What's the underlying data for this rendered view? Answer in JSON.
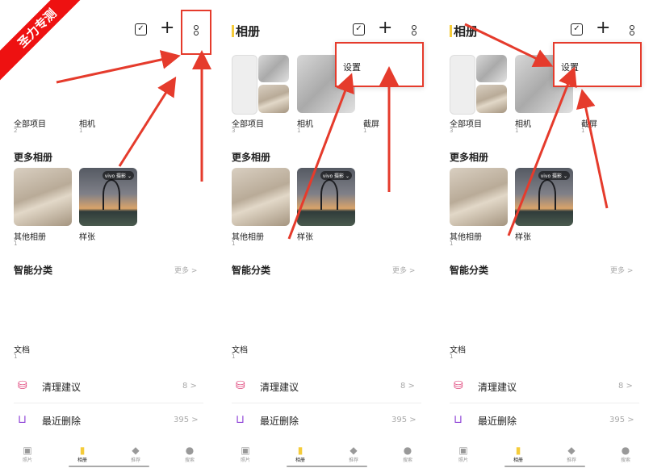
{
  "colors": {
    "accent": "#f5cc3a",
    "annotation": "#e53b2c"
  },
  "header": {
    "title": "相册"
  },
  "ribbon": "圣力专测",
  "albums_top": [
    {
      "name": "全部项目",
      "count": "2"
    },
    {
      "name": "相机",
      "count": "1"
    }
  ],
  "albums_top_p2": [
    {
      "name": "全部项目",
      "count": "3"
    },
    {
      "name": "相机",
      "count": "1"
    },
    {
      "name": "截屏",
      "count": "1"
    }
  ],
  "albums_top_p3": [
    {
      "name": "全部项目",
      "count": "3"
    },
    {
      "name": "相机",
      "count": "1"
    },
    {
      "name": "截屏",
      "count": "1"
    }
  ],
  "more_albums": {
    "title": "更多相册",
    "items": [
      {
        "name": "其他相册",
        "count": "1"
      },
      {
        "name": "样张",
        "badge": "vivo 摄影 ⌄"
      }
    ]
  },
  "smart": {
    "title": "智能分类",
    "more": "更多 >"
  },
  "docs": {
    "name": "文档",
    "count": "1"
  },
  "rows": [
    {
      "icon": "broom-icon",
      "glyph": "⛁",
      "label": "清理建议",
      "count": "8 >",
      "color": "#e0457b"
    },
    {
      "icon": "trash-icon",
      "glyph": "🗑",
      "label": "最近删除",
      "count": "395 >",
      "color": "#8c3fd6"
    }
  ],
  "popup": {
    "item": "设置"
  },
  "nav": [
    {
      "label": "照片",
      "icon": "photo-icon",
      "glyph": "▣"
    },
    {
      "label": "相册",
      "icon": "album-icon",
      "glyph": "▮",
      "active": true
    },
    {
      "label": "推荐",
      "icon": "diamond-icon",
      "glyph": "◆"
    },
    {
      "label": "搜索",
      "icon": "search-icon",
      "glyph": "●"
    }
  ]
}
